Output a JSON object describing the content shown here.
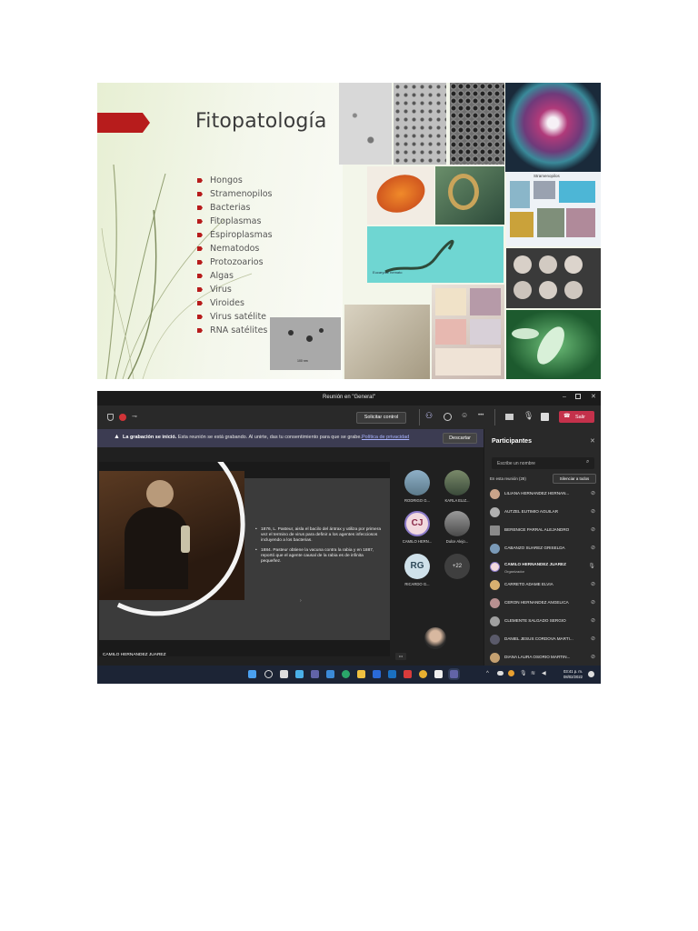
{
  "slide": {
    "title": "Fitopatología",
    "bullets": [
      "Hongos",
      "Stramenopilos",
      "Bacterias",
      "Fitoplasmas",
      "Espiroplasmas",
      "Nematodos",
      "Protozoarios",
      "Algas",
      "Virus",
      "Viroides",
      "Virus satélite",
      "RNA satélites"
    ],
    "scale_label": "100 nm",
    "strameno_label": "Stramenopilos",
    "eucaryote_label": "Eucaryote nemato",
    "accent_color": "#b71c1c"
  },
  "teams": {
    "window_title": "Reunión en \"General\"",
    "toolbar": {
      "request_control": "Solicitar control",
      "more": "•••",
      "leave": "Salir"
    },
    "banner": {
      "bold": "La grabación se inició.",
      "text": " Esta reunión se está grabando. Al unirte, das tu consentimiento para que se grabe.",
      "link": "Política de privacidad",
      "dismiss": "Descartar"
    },
    "shared_slide": {
      "bullet1": "1876, L. Pasteur, aisla el bacilo del ántrax y utiliza por primera vez el termino de virus para definir a los agentes infecciosos incluyendo a los bacterias.",
      "bullet2": "1884. Pasteur obtiene la vacuna contra la rabia y en 1887, reportó que el agente causal de la rabia es de infinita pequeñez."
    },
    "presenter_name": "CAMILO HERNANDEZ JUAREZ",
    "tiles": [
      {
        "name": "RODRIGO G..."
      },
      {
        "name": "KARLA ELIZ..."
      },
      {
        "initials": "CJ",
        "name": "CAMILO HERN..."
      },
      {
        "name": "Dulce Alejo..."
      },
      {
        "initials": "RG",
        "name": "RICARDO G..."
      },
      {
        "initials": "+22",
        "name": ""
      }
    ],
    "self_more": "•••",
    "participants": {
      "header": "Participantes",
      "search_placeholder": "Escribe un nombre",
      "in_meeting": "En esta reunión (28)",
      "mute_all": "Silenciar a todos",
      "list": [
        {
          "name": "LILIANA HERNANDEZ HERNAN...",
          "role": ""
        },
        {
          "name": "AUTZEL EUTIMIO AGUILAR",
          "role": ""
        },
        {
          "name": "BERENICE PARRAL ALEJANDRO",
          "role": ""
        },
        {
          "name": "CABANZO SUAREZ GRISELDA",
          "role": ""
        },
        {
          "name": "CAMILO HERNANDEZ JUAREZ",
          "role": "Organizador"
        },
        {
          "name": "CARRETO ADAME ELVIA",
          "role": ""
        },
        {
          "name": "CERON HERNANDEZ ANGELICA",
          "role": ""
        },
        {
          "name": "CLEMENTE SALGADO SERGIO",
          "role": ""
        },
        {
          "name": "DANIEL JESUS CORDOVA MARTI...",
          "role": ""
        },
        {
          "name": "DIANA LAURA OSORIO MARTIN...",
          "role": ""
        }
      ]
    },
    "taskbar": {
      "time": "03:41 p. m.",
      "date": "08/02/2022"
    },
    "colors": {
      "leave": "#c4314b",
      "banner": "#3c3c52",
      "taskbar": "#1c2435"
    }
  }
}
